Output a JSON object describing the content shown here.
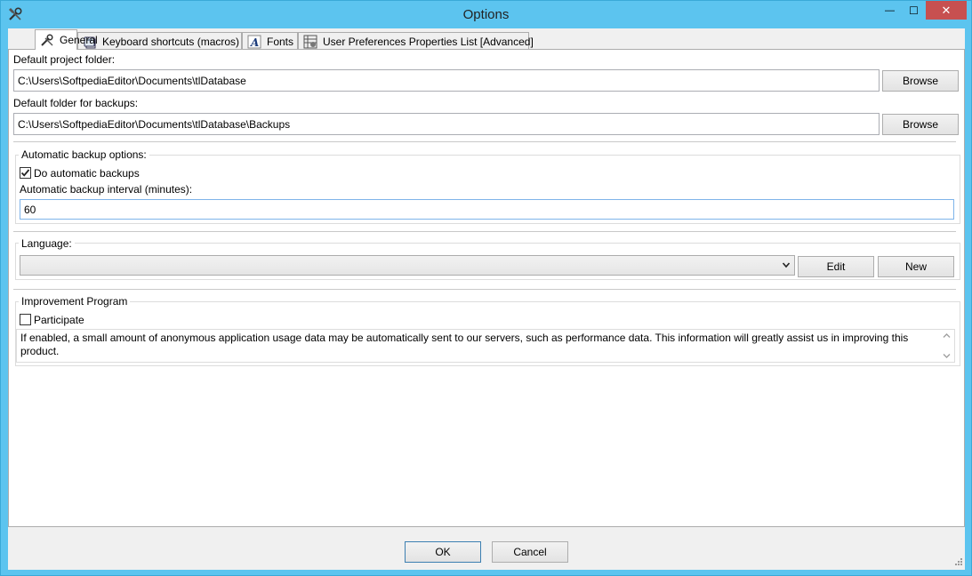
{
  "window": {
    "title": "Options",
    "minimize_glyph": "—",
    "maximize_glyph": "☐",
    "close_glyph": "✕"
  },
  "tabs": [
    {
      "label": "General",
      "icon": "tools-icon",
      "active": true
    },
    {
      "label": "Keyboard shortcuts (macros)",
      "icon": "keyboard-icon",
      "active": false
    },
    {
      "label": "Fonts",
      "icon": "font-icon",
      "active": false
    },
    {
      "label": "User Preferences Properties List [Advanced]",
      "icon": "properties-list-icon",
      "active": false
    }
  ],
  "general": {
    "project_folder_label": "Default project folder:",
    "project_folder_value": "C:\\Users\\SoftpediaEditor\\Documents\\tlDatabase",
    "backup_folder_label": "Default folder for backups:",
    "backup_folder_value": "C:\\Users\\SoftpediaEditor\\Documents\\tlDatabase\\Backups",
    "browse_label": "Browse"
  },
  "backup": {
    "group_title": "Automatic backup options:",
    "auto_backup_label": "Do automatic backups",
    "auto_backup_checked": true,
    "interval_label": "Automatic backup interval (minutes):",
    "interval_value": "60"
  },
  "language": {
    "group_title": "Language:",
    "selected": "",
    "edit_label": "Edit",
    "new_label": "New"
  },
  "improvement": {
    "group_title": "Improvement Program",
    "participate_label": "Participate",
    "participate_checked": false,
    "description": "If enabled, a small amount of anonymous application usage data may be automatically sent to our servers, such as performance data. This information will greatly assist us in improving this product."
  },
  "footer": {
    "ok_label": "OK",
    "cancel_label": "Cancel"
  },
  "colors": {
    "titlebar": "#5cc4ef",
    "close_button": "#c75050",
    "focus_border": "#7eb4ea"
  }
}
